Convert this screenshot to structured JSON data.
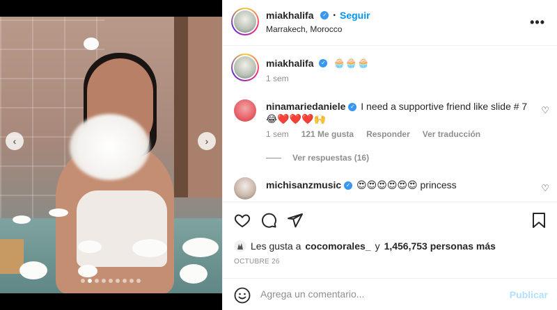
{
  "header": {
    "username": "miakhalifa",
    "separator": "•",
    "follow_label": "Seguir",
    "location": "Marrakech, Morocco",
    "more_label": "•••"
  },
  "caption": {
    "username": "miakhalifa",
    "text": "🧁🧁🧁",
    "time": "1 sem"
  },
  "comments": [
    {
      "username": "ninamariedaniele",
      "text": "I need a supportive friend like slide # 7 😂❤️❤️❤️🙌",
      "time": "1 sem",
      "likes": "121 Me gusta",
      "reply_label": "Responder",
      "translate_label": "Ver traducción",
      "view_replies": "Ver respuestas (16)"
    },
    {
      "username": "michisanzmusic",
      "text": "😍😍😍😍😍😍 princess"
    }
  ],
  "likes": {
    "prefix": "Les gusta a",
    "user": "cocomorales_",
    "middle": "y",
    "count": "1,456,753 personas más"
  },
  "date": "OCTUBRE 26",
  "composer": {
    "placeholder": "Agrega un comentario...",
    "publish_label": "Publicar"
  },
  "carousel": {
    "slides": 9,
    "active": 1
  },
  "colors": {
    "accent": "#0095f6",
    "verified": "#3897f0",
    "publish_disabled": "#b2dffc",
    "muted": "#8e8e8e"
  }
}
